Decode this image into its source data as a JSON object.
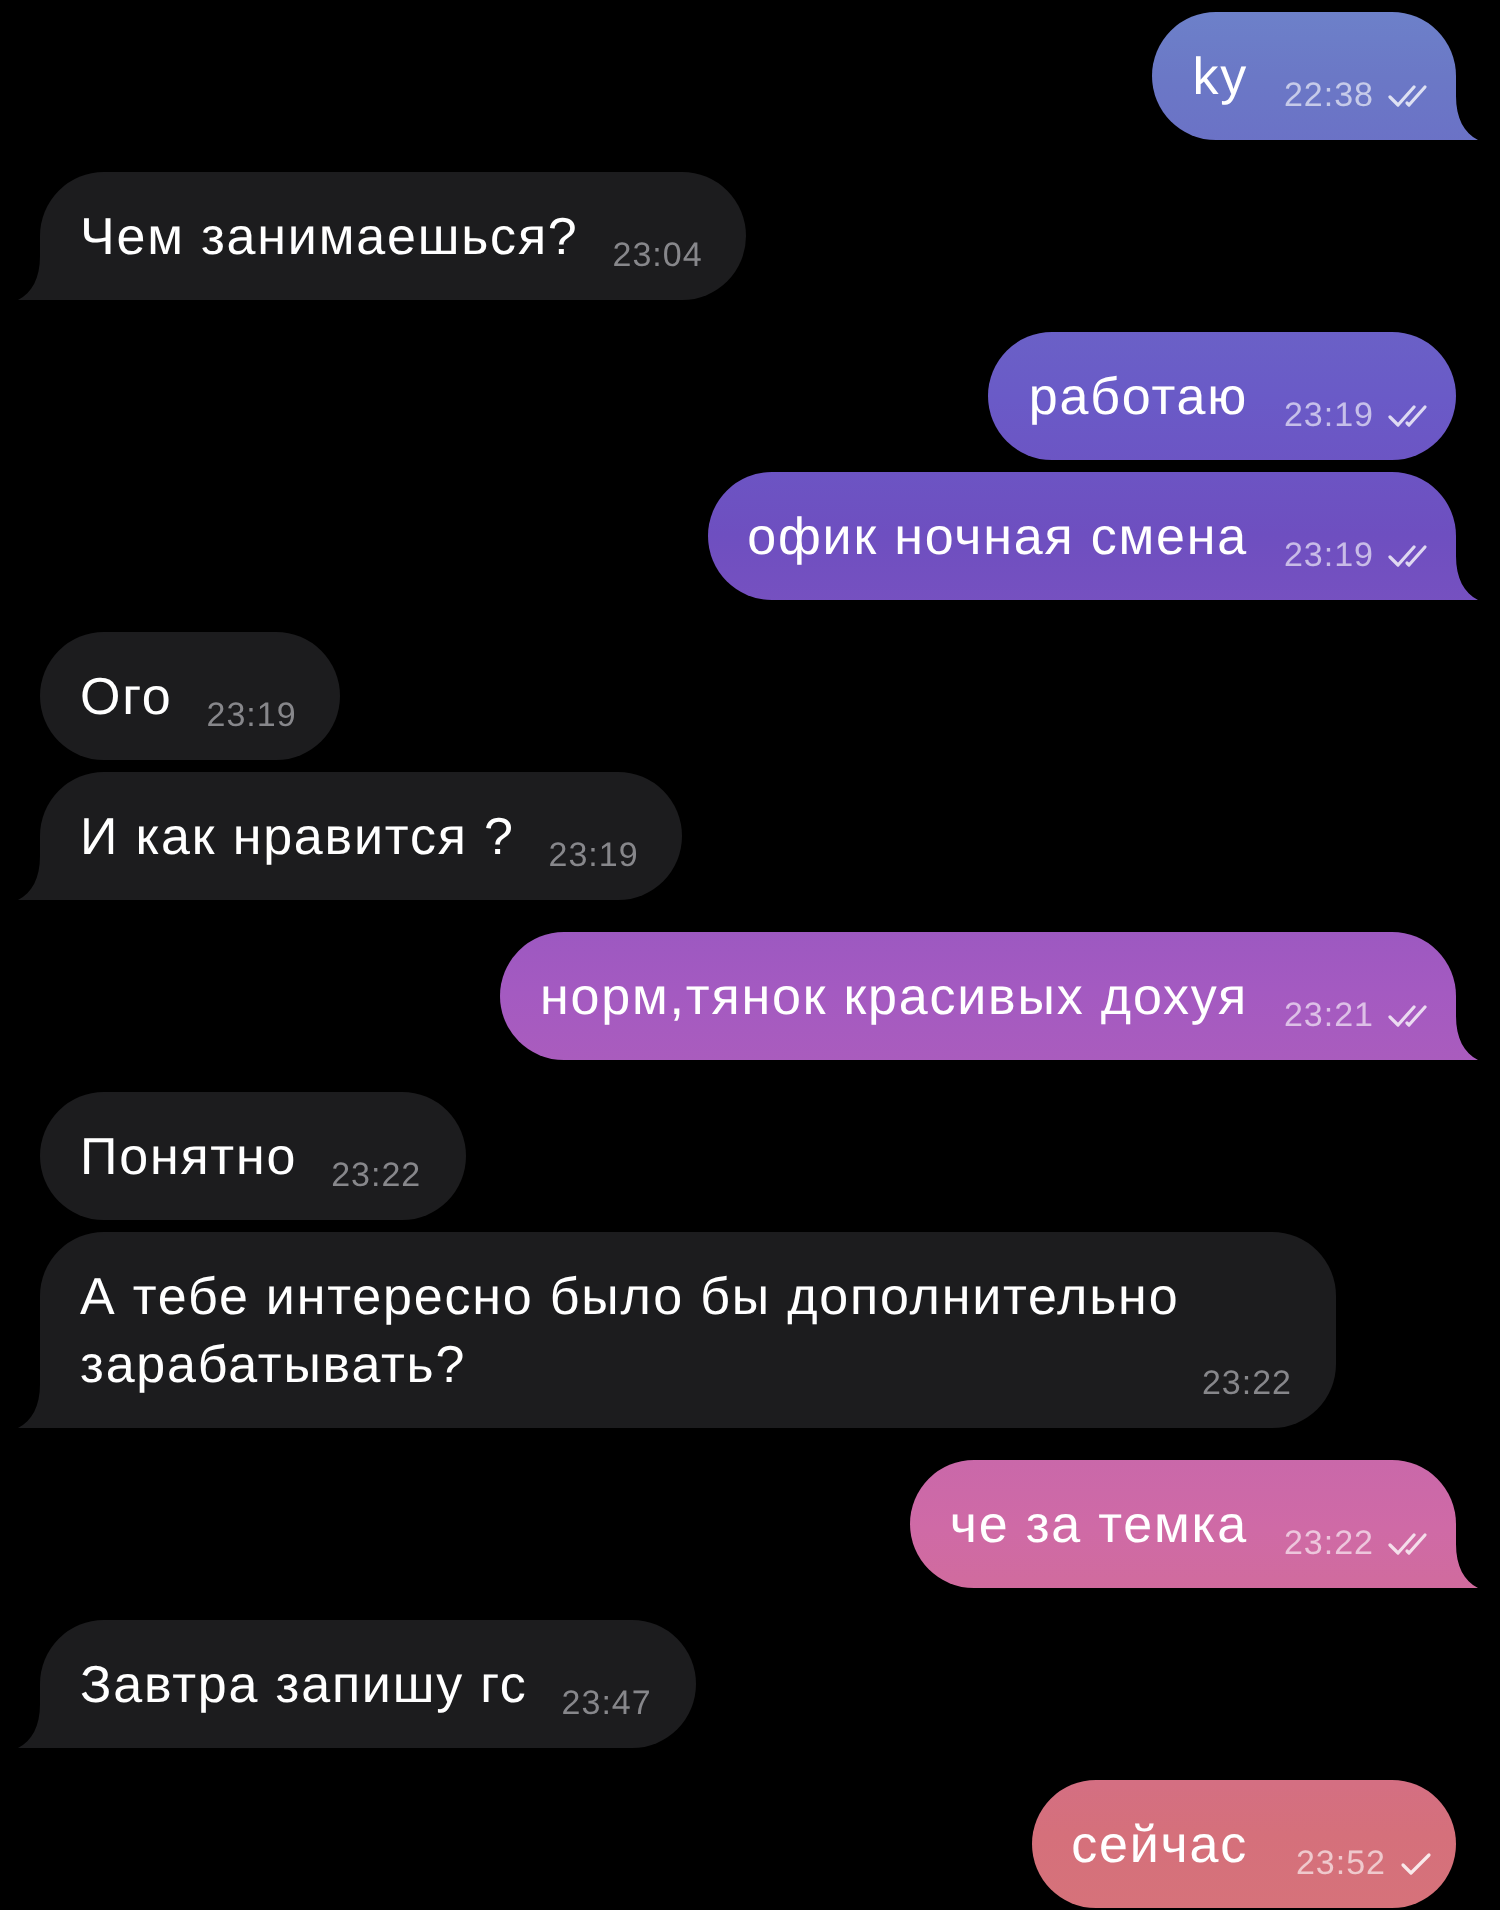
{
  "messages": [
    {
      "kind": "outgoing",
      "text": "ky",
      "time": "22:38",
      "read": true,
      "tail": true
    },
    {
      "kind": "incoming",
      "text": "Чем занимаешься?",
      "time": "23:04",
      "tail": true
    },
    {
      "kind": "outgoing",
      "text": "работаю",
      "time": "23:19",
      "read": true,
      "tail": false
    },
    {
      "kind": "outgoing",
      "text": "офик ночная смена",
      "time": "23:19",
      "read": true,
      "tail": true
    },
    {
      "kind": "incoming",
      "text": "Ого",
      "time": "23:19",
      "tail": false
    },
    {
      "kind": "incoming",
      "text": "И как нравится ?",
      "time": "23:19",
      "tail": true
    },
    {
      "kind": "outgoing",
      "text": "норм,тянок красивых дохуя",
      "time": "23:21",
      "read": true,
      "tail": true
    },
    {
      "kind": "incoming",
      "text": "Понятно",
      "time": "23:22",
      "tail": false
    },
    {
      "kind": "incoming",
      "text": "А тебе интересно было бы дополнительно зарабатывать?",
      "time": "23:22",
      "tail": true
    },
    {
      "kind": "outgoing",
      "text": "че за темка",
      "time": "23:22",
      "read": true,
      "tail": true
    },
    {
      "kind": "incoming",
      "text": "Завтра запишу гс",
      "time": "23:47",
      "tail": true
    },
    {
      "kind": "outgoing",
      "text": "сейчас",
      "time": "23:52",
      "read": false,
      "tail": false
    }
  ]
}
